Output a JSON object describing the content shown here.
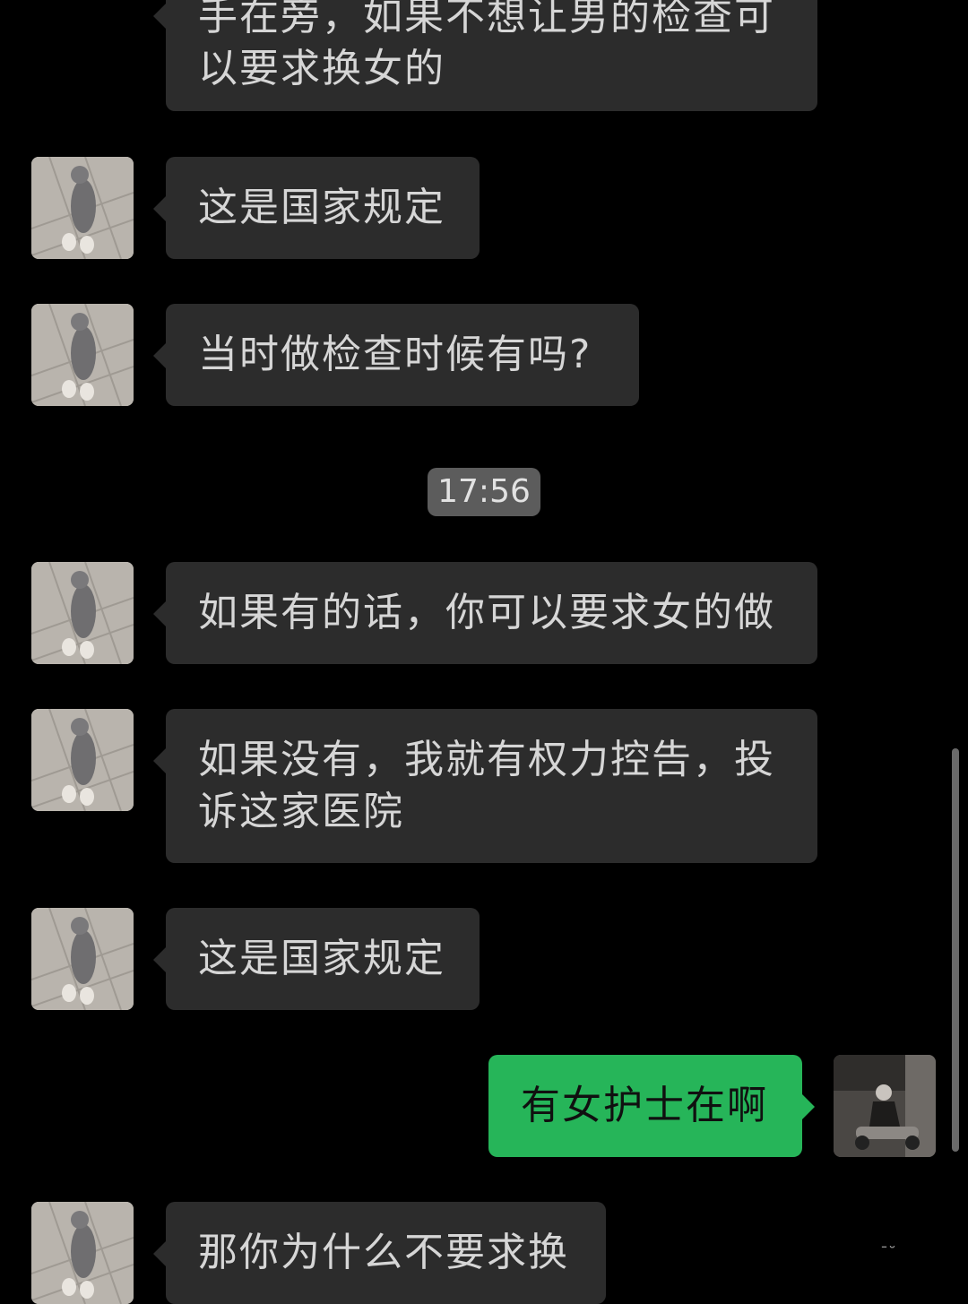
{
  "timestamp": "17:56",
  "messages": [
    {
      "side": "left",
      "text_line1": "手在旁，如果不想让男的检查可",
      "text_line2": "以要求换女的"
    },
    {
      "side": "left",
      "text": "这是国家规定"
    },
    {
      "side": "left",
      "text": "当时做检查时候有吗?"
    },
    {
      "side": "left",
      "text": "如果有的话，你可以要求女的做"
    },
    {
      "side": "left",
      "text_line1": "如果没有，我就有权力控告，投",
      "text_line2": "诉这家医院"
    },
    {
      "side": "left",
      "text": "这是国家规定"
    },
    {
      "side": "right",
      "text": "有女护士在啊"
    },
    {
      "side": "left",
      "text": "那你为什么不要求换"
    }
  ],
  "colors": {
    "background": "#000000",
    "incoming_bubble": "#2c2c2c",
    "outgoing_bubble": "#26b559",
    "timestamp_pill": "#5c5c5c"
  },
  "icons": {
    "contact_avatar": "dog-photo-avatar",
    "self_avatar": "scooter-rider-photo-avatar"
  }
}
